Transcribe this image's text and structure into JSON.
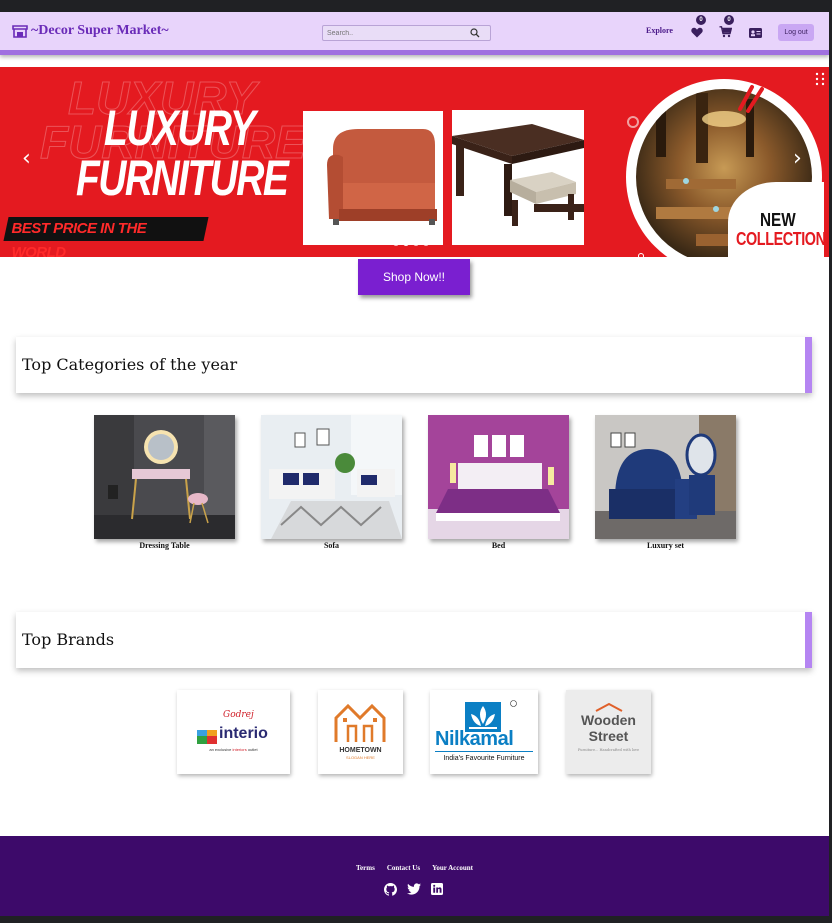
{
  "navbar": {
    "brand": "~Decor Super Market~",
    "search_placeholder": "Search..",
    "explore": "Explore",
    "wishlist_count": "0",
    "cart_count": "0",
    "logout": "Log out"
  },
  "banner": {
    "headline_line1": "LUXURY",
    "headline_line2": "FURNITURE",
    "tagline": "BEST PRICE IN THE WORLD",
    "badge_line1": "NEW",
    "badge_line2": "COLLECTION",
    "active_slide_index": 1,
    "slide_count": 4
  },
  "shop_button": "Shop Now!!",
  "categories": {
    "title": "Top Categories of the year",
    "items": [
      {
        "label": "Dressing Table"
      },
      {
        "label": "Sofa"
      },
      {
        "label": "Bed"
      },
      {
        "label": "Luxury set"
      }
    ]
  },
  "brands": {
    "title": "Top Brands",
    "godrej_script": "Godrej",
    "interio": "interio",
    "interio_sub_prefix": "an exclusive",
    "interio_sub_highlight": "interiors",
    "interio_sub_suffix": "outlet",
    "hometown": "HOMETOWN",
    "hometown_sub": "SLOGAN HERE",
    "nilkamal": "Nilkamal",
    "nilkamal_tagline": "India's Favourite Furniture",
    "wooden_line1": "Wooden",
    "wooden_line2": "Street",
    "wooden_sub": "Furniture... Handcrafted with love"
  },
  "footer": {
    "links": [
      "Terms",
      "Contact Us",
      "Your Account"
    ]
  },
  "colors": {
    "primary": "#7a1fd0",
    "navbar_bg": "#e8d4fb",
    "footer_bg": "#3d0a6a",
    "banner_red": "#e41a20",
    "accent": "#b585f2"
  }
}
